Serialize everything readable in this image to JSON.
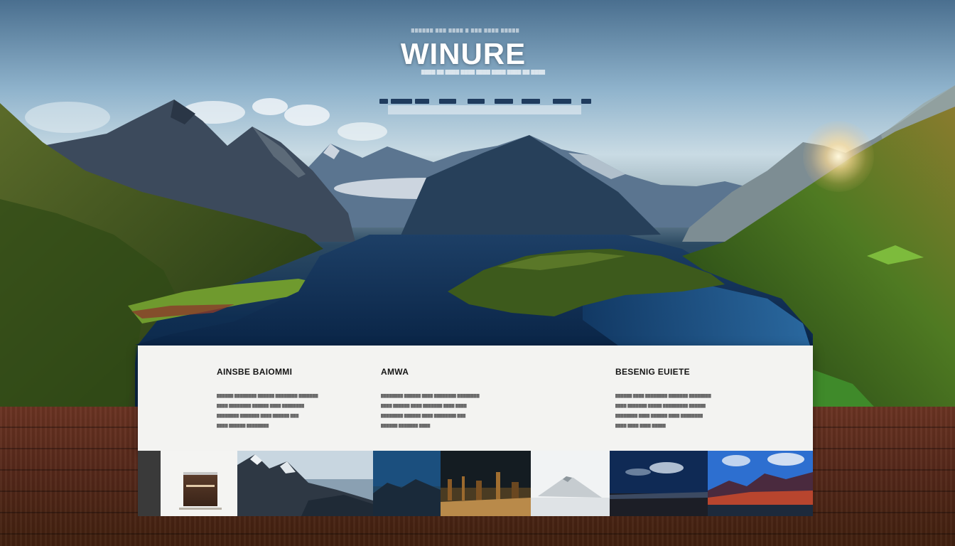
{
  "header": {
    "eyebrow": "██████ ███ ████ █ ███ ████ █████",
    "title": "WINURE",
    "tagline": "████ ██ ████ ████ ████ ████ ████ ██ ████"
  },
  "nav": {
    "segments": 8
  },
  "columns": [
    {
      "heading": "AINSBE BAIOMMI",
      "lines": [
        "██████ ████████ ██████ ████████ ███████",
        "████ ████████ ██████ ████ ████████",
        "████████ ███████ ████ ██████ ███",
        "████ ██████ ████████"
      ]
    },
    {
      "heading": "AMWA",
      "lines": [
        "████████ ██████ ████ ████████ ████████",
        "████ ██████ ████ ███████ ████ ████",
        "████████ ██████ ████ ████████ ███",
        "██████ ███████ ████"
      ]
    },
    {
      "heading": "BESENIG EUIETE",
      "lines": [
        "██████ ████ ████████ ███████ ████████",
        "████ ███████ █████ █████████ ██████",
        "████████ ████ ██████ ████ ████████",
        "████ ████ ████ █████"
      ]
    }
  ],
  "thumbnails": [
    {
      "name": "thumb-dark-panel",
      "kind": "panel"
    },
    {
      "name": "thumb-book",
      "kind": "book"
    },
    {
      "name": "thumb-mountain-peaks",
      "kind": "mountains"
    },
    {
      "name": "thumb-blue-mountains",
      "kind": "bluemountain"
    },
    {
      "name": "thumb-night-ruins",
      "kind": "ruins"
    },
    {
      "name": "thumb-misty-peak",
      "kind": "misty"
    },
    {
      "name": "thumb-night-plain",
      "kind": "nightplain"
    },
    {
      "name": "thumb-sunset-mountains",
      "kind": "sunset"
    }
  ],
  "colors": {
    "card_bg": "#f3f3f1",
    "nav_segment": "#1f3c5e",
    "floor_wood": "#55281a",
    "lake_blue": "#0f2e52",
    "forest_green": "#3d5a1c"
  }
}
